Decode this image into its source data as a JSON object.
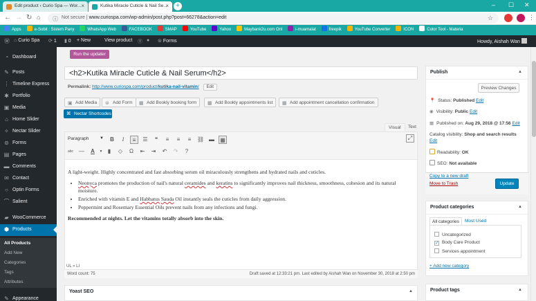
{
  "browser": {
    "tabs": [
      {
        "label": "Edit product ‹ Curio Spa — Wor..."
      },
      {
        "label": "Kutika Miracle Cuticle & Nail Se..."
      }
    ],
    "new_tab": "+",
    "address": {
      "security": "Not secure",
      "separator": "|",
      "url": "www.curiospa.com/wp-admin/post.php?post=66278&action=edit"
    },
    "bookmarks": [
      {
        "label": "Apps",
        "color": "#4285f4"
      },
      {
        "label": "e-Sobit : Sistem Pany",
        "color": "#f4b400"
      },
      {
        "label": "WhatsApp Web",
        "color": "#25d366"
      },
      {
        "label": "FACEBOOK",
        "color": "#3b5998"
      },
      {
        "label": "SMAP",
        "color": "#e53935"
      },
      {
        "label": "YouTube",
        "color": "#ff0000"
      },
      {
        "label": "Yahoo",
        "color": "#5f01d1"
      },
      {
        "label": "Maybank2u.com Onl",
        "color": "#ffc600"
      },
      {
        "label": "i-muamalat",
        "color": "#8e24aa"
      },
      {
        "label": "freepik",
        "color": "#1273eb"
      },
      {
        "label": "YouTube Converter",
        "color": "#f4b400"
      },
      {
        "label": "ICON",
        "color": "#f4b400"
      },
      {
        "label": "Color Tool - Materia",
        "color": "#ffffff"
      }
    ]
  },
  "adminbar": {
    "site": "Curio Spa",
    "updates": "1",
    "comments": "0",
    "new": "New",
    "view": "View product",
    "forms": "Forms",
    "greeting": "Howdy, Aishah Wan"
  },
  "sidebar": {
    "items": [
      {
        "label": "Dashboard",
        "icon": "dashboard-icon"
      },
      {
        "label": "Posts",
        "icon": "pin-icon"
      },
      {
        "label": "Timeline Express",
        "icon": "timeline-icon"
      },
      {
        "label": "Portfolio",
        "icon": "portfolio-icon"
      },
      {
        "label": "Media",
        "icon": "media-icon"
      },
      {
        "label": "Home Slider",
        "icon": "slider-icon"
      },
      {
        "label": "Nectar Slider",
        "icon": "star-icon"
      },
      {
        "label": "Forms",
        "icon": "forms-icon"
      },
      {
        "label": "Pages",
        "icon": "pages-icon"
      },
      {
        "label": "Comments",
        "icon": "comments-icon"
      },
      {
        "label": "Contact",
        "icon": "contact-icon"
      },
      {
        "label": "Optin Forms",
        "icon": "optin-icon"
      },
      {
        "label": "Salient",
        "icon": "salient-icon"
      },
      {
        "label": "WooCommerce",
        "icon": "woocommerce-icon"
      },
      {
        "label": "Products",
        "icon": "products-icon"
      },
      {
        "label": "Appearance",
        "icon": "appearance-icon"
      }
    ],
    "submenu": [
      "All Products",
      "Add New",
      "Categories",
      "Tags",
      "Attributes"
    ]
  },
  "notice": {
    "button": "Run the updater"
  },
  "editor": {
    "title": "<h2>Kutika Miracle Cuticle & Nail Serum</h2>",
    "permalink_label": "Permalink:",
    "permalink_base": "http://www.curiospa.com/product/",
    "permalink_slug": "kutika-nail-vitamin",
    "permalink_end": "/",
    "edit_button": "Edit",
    "media_buttons": [
      "Add Media",
      "Add Form",
      "Add Bookly booking form",
      "Add Bookly appointments list",
      "Add appointment cancellation confirmation"
    ],
    "nectar_button": "Nectar Shortcodes",
    "tabs": [
      "Visual",
      "Text"
    ],
    "format_select": "Paragraph",
    "intro": "A light-weight. Highly concentrated and fast absorbing serum oil miraculously strengthens and hydrated nails and cuticles.",
    "bullet1": {
      "a": "Neonyca",
      "b": " promotes the production of nail's natural ",
      "c": "ceramides",
      "d": " and ",
      "e": "keratins",
      "f": " to significantly improves nail thickness, smoothness, cohesion and its natural moisture."
    },
    "bullet2": {
      "a": "Enriched with vitamin E and ",
      "b": "Habbatus",
      "c": " ",
      "d": "Sauda",
      "e": " Oil instantly seals the cuticles from daily aggression."
    },
    "bullet3": "Peppermint and Rosemary Essential Oils prevent nails from any infections and fungi.",
    "closing": "Recommended at nights. Let the vitamins totally absorb into the skin.",
    "path": "UL » LI",
    "word_count": "Word count: 75",
    "draft_status": "Draft saved at 12:33:21 pm. Last edited by Aishah Wan on November 30, 2018 at 2:50 pm"
  },
  "yoast": {
    "title": "Yoast SEO"
  },
  "publish": {
    "title": "Publish",
    "preview": "Preview Changes",
    "status_label": "Status:",
    "status_value": "Published",
    "status_edit": "Edit",
    "visibility_label": "Visibility:",
    "visibility_value": "Public",
    "visibility_edit": "Edit",
    "published_label": "Published on:",
    "published_value": "Aug 29, 2018 @ 17:56",
    "published_edit": "Edit",
    "catalog_label": "Catalog visibility:",
    "catalog_value": "Shop and search results",
    "catalog_edit": "Edit",
    "readability_label": "Readability:",
    "readability_value": "OK",
    "seo_label": "SEO:",
    "seo_value": "Not available",
    "copy_draft": "Copy to a new draft",
    "trash": "Move to Trash",
    "update": "Update"
  },
  "categories": {
    "title": "Product categories",
    "tabs": [
      "All categories",
      "Most Used"
    ],
    "items": [
      {
        "label": "Uncategorized",
        "checked": false
      },
      {
        "label": "Body Care Product",
        "checked": true
      },
      {
        "label": "Services appointment",
        "checked": false
      }
    ],
    "add_link": "+ Add new category"
  },
  "tags": {
    "title": "Product tags"
  }
}
